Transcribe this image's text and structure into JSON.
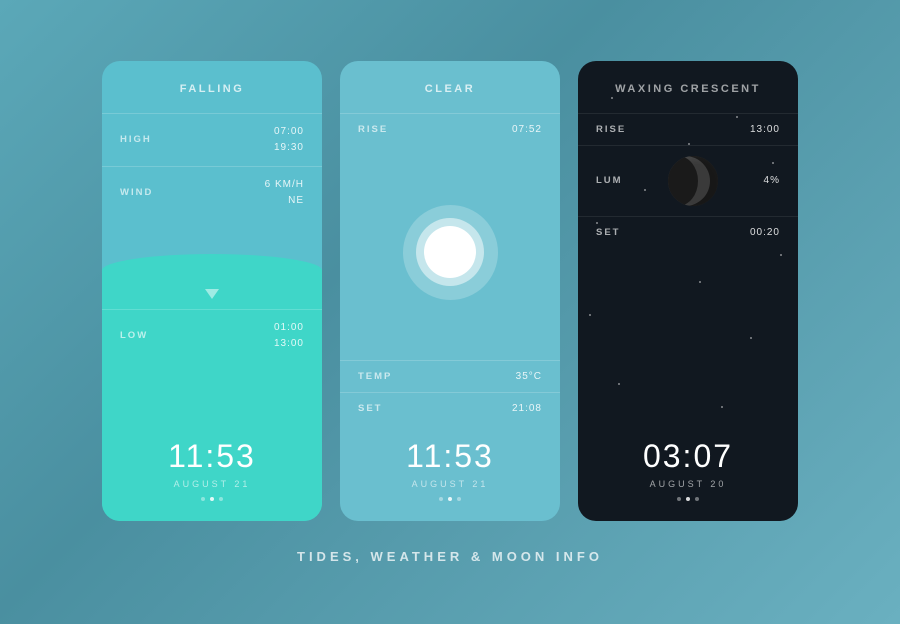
{
  "page": {
    "title": "TIDES, WEATHER & MOON INFO"
  },
  "tides": {
    "header": "FALLING",
    "high_label": "HIGH",
    "high_time": "07:00",
    "high_value": "19:30",
    "wind_label": "WIND",
    "wind_speed": "6 KM/H",
    "wind_dir": "NE",
    "low_label": "LOW",
    "low_time": "01:00",
    "low_value": "13:00",
    "time": "11:53",
    "date": "AUGUST 21",
    "dots": [
      0,
      1,
      0
    ]
  },
  "weather": {
    "header": "CLEAR",
    "rise_label": "RISE",
    "rise_value": "07:52",
    "temp_label": "TEMP",
    "temp_value": "35°C",
    "set_label": "SET",
    "set_value": "21:08",
    "time": "11:53",
    "date": "AUGUST 21",
    "dots": [
      0,
      1,
      0
    ]
  },
  "moon": {
    "header": "WAXING CRESCENT",
    "rise_label": "RISE",
    "rise_value": "13:00",
    "lum_label": "LUM",
    "lum_value": "4%",
    "set_label": "SET",
    "set_value": "00:20",
    "time": "03:07",
    "date": "AUGUST 20",
    "dots": [
      0,
      1,
      0
    ]
  }
}
